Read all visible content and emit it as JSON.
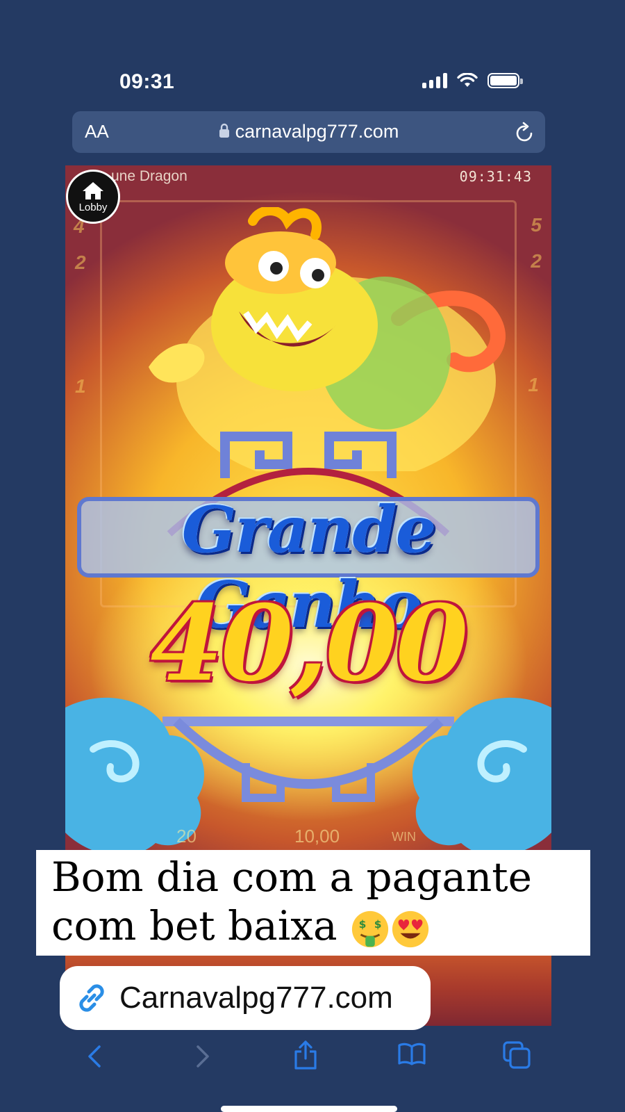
{
  "status_bar": {
    "time": "09:31"
  },
  "browser": {
    "text_size_label": "AA",
    "url": "carnavalpg777.com"
  },
  "game": {
    "title": "une Dragon",
    "clock": "09:31:43",
    "lobby_label": "Lobby",
    "big_win_title": "Grande Ganho",
    "win_amount": "40,00",
    "side_numbers_right": [
      "5",
      "2",
      "1"
    ],
    "side_numbers_left": [
      "4",
      "2",
      "1"
    ],
    "readout_left": "20",
    "readout_center": "10,00",
    "readout_right": "WIN"
  },
  "caption": {
    "text": "Bom dia com a pagante com bet baixa",
    "emojis": [
      "money-mouth-face",
      "heart-eyes-face"
    ]
  },
  "link_sticker": {
    "text": "Carnavalpg777.com"
  },
  "toolbar": {
    "items": [
      "back-icon",
      "forward-icon",
      "share-icon",
      "bookmarks-icon",
      "tabs-icon"
    ]
  },
  "colors": {
    "background": "#243a63",
    "address_bar": "#3d5580",
    "toolbar_icon": "#2a7be6",
    "toolbar_icon_disabled": "#5a6e94"
  }
}
